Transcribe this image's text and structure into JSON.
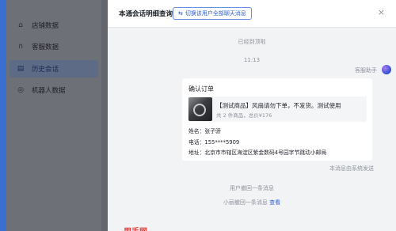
{
  "sidebar": {
    "items": [
      {
        "label": "店铺数据",
        "icon": "store-icon",
        "glyph": "⌂"
      },
      {
        "label": "客服数据",
        "icon": "headset-icon",
        "glyph": "∩"
      },
      {
        "label": "历史会话",
        "icon": "document-icon",
        "glyph": "▤"
      },
      {
        "label": "机器人数据",
        "icon": "robot-icon",
        "glyph": "◎"
      }
    ],
    "active_index": 2
  },
  "panel": {
    "title": "本通会话明细查询",
    "switch_label": "切换该用户全部聊天消息",
    "switch_icon": "⇆",
    "close_glyph": "×"
  },
  "chat": {
    "reached_top": "已经到顶啦",
    "time": "11:13",
    "sender_name": "客服助手",
    "card": {
      "title": "确认订单",
      "goods_name": "【测试商品】风扇请勿下单，不发货。测试使用",
      "goods_sub": "共 2 件商品，总价¥176",
      "name_line": "姓名：张子骄",
      "phone_line": "电话：155****5909",
      "address_line": "地址：北京市市辖区海淀区紫金数码4号园字节跳动小邮局"
    },
    "system_sent": "本消息由系统发送",
    "user_recalled": "用户撤回一条消息",
    "agent_recalled": "小丽撤回一条消息",
    "view_link": "查看"
  },
  "footer_tag": "用手网"
}
